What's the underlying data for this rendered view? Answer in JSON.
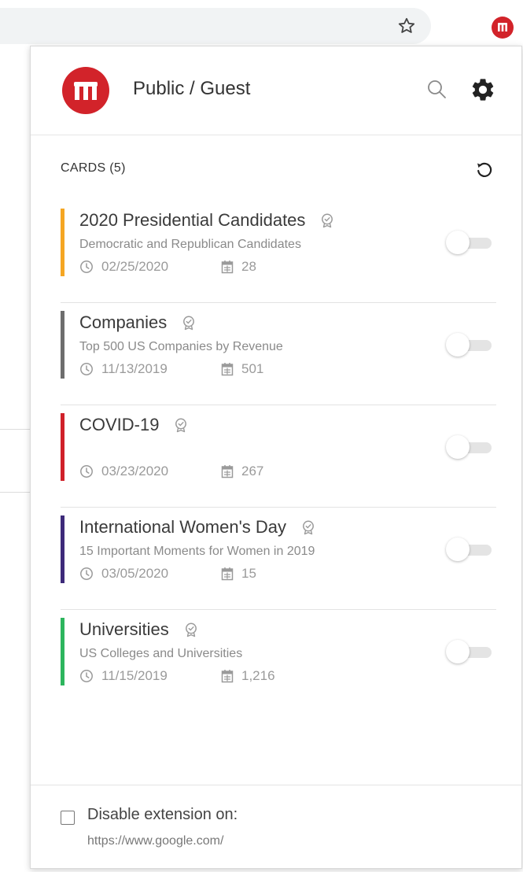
{
  "browser": {
    "star_icon": "star-outline-icon",
    "extension_icon": "extension-logo-icon"
  },
  "header": {
    "title": "Public / Guest",
    "logo_color": "#d2232a",
    "search_icon": "search-icon",
    "settings_icon": "gear-icon"
  },
  "cards_section": {
    "heading": "CARDS (5)",
    "refresh_icon": "refresh-icon"
  },
  "cards": [
    {
      "title": "2020 Presidential Candidates",
      "subtitle": "Democratic and Republican Candidates",
      "date": "02/25/2020",
      "count": "28",
      "color": "#f5a623",
      "enabled": false
    },
    {
      "title": "Companies",
      "subtitle": "Top 500 US Companies by Revenue",
      "date": "11/13/2019",
      "count": "501",
      "color": "#6d6d6d",
      "enabled": false
    },
    {
      "title": "COVID-19",
      "subtitle": "",
      "date": "03/23/2020",
      "count": "267",
      "color": "#d0212a",
      "enabled": false
    },
    {
      "title": "International Women's Day",
      "subtitle": "15 Important Moments for Women in 2019",
      "date": "03/05/2020",
      "count": "15",
      "color": "#3d2a7a",
      "enabled": false
    },
    {
      "title": "Universities",
      "subtitle": "US Colleges and Universities",
      "date": "11/15/2019",
      "count": "1,216",
      "color": "#2db55d",
      "enabled": false
    }
  ],
  "footer": {
    "label": "Disable extension on:",
    "url": "https://www.google.com/",
    "checked": false
  }
}
